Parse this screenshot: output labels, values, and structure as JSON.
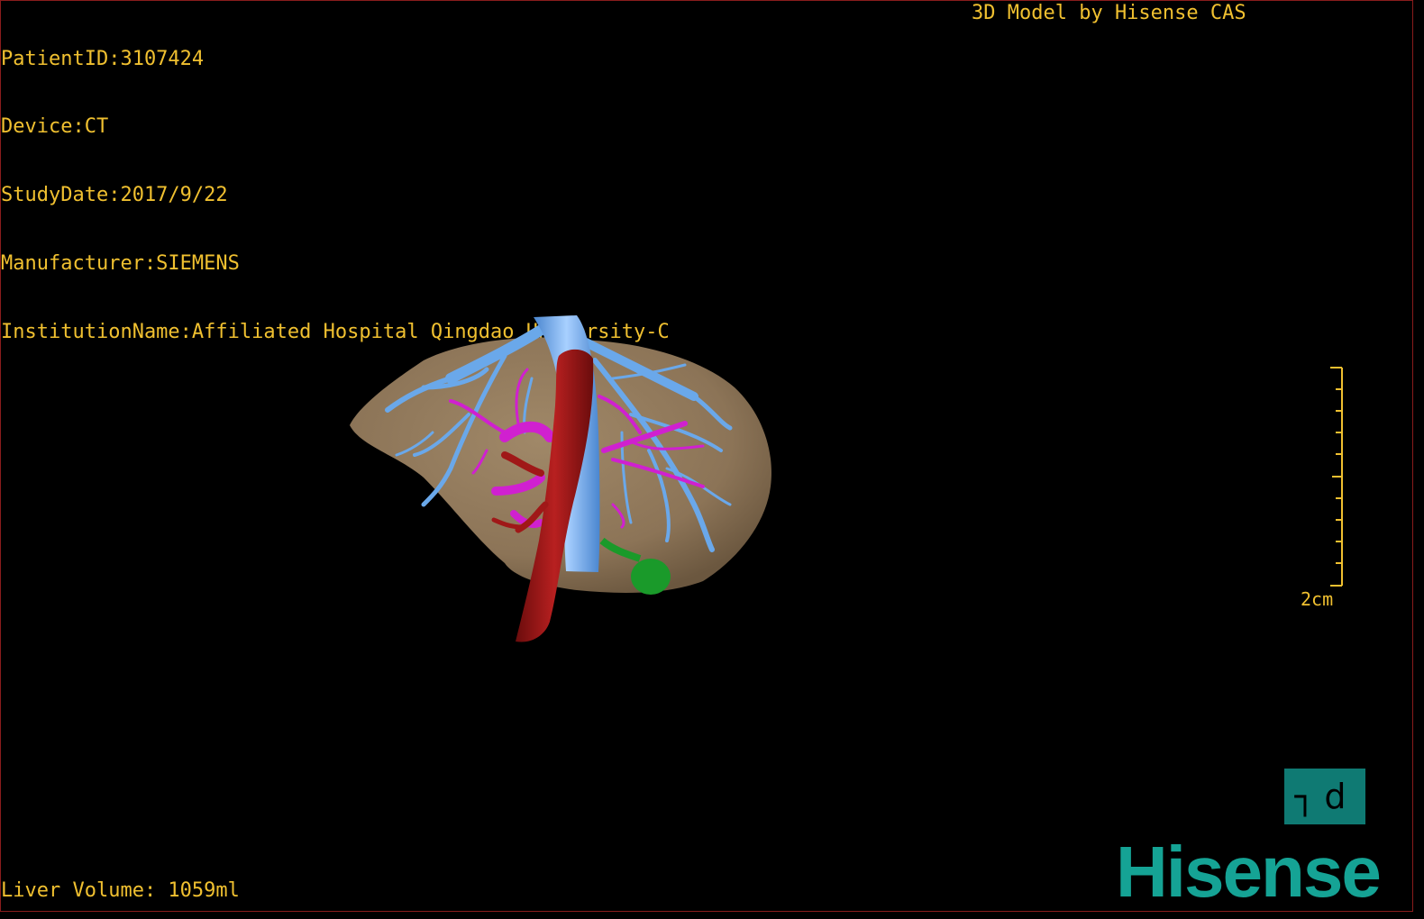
{
  "overlay": {
    "patient_id": "PatientID:3107424",
    "device": "Device:CT",
    "study_date": "StudyDate:2017/9/22",
    "manufacturer": "Manufacturer:SIEMENS",
    "institution": "InstitutionName:Affiliated Hospital Qingdao University-C",
    "credit": "3D Model by Hisense CAS",
    "liver_volume": "Liver Volume: 1059ml",
    "scale_label": "2cm"
  },
  "orientation_cube": {
    "label": "┐d"
  },
  "logo": {
    "text": "Hisense",
    "color": "#15a395"
  },
  "colors": {
    "text": "#f0c030",
    "liver": "#8c7457",
    "hepatic_vein": "#6aa8ea",
    "portal_vein": "#d020d0",
    "artery_ivc": "#a01818",
    "gallbladder": "#1a9a2a",
    "border": "#8a1c1c"
  }
}
